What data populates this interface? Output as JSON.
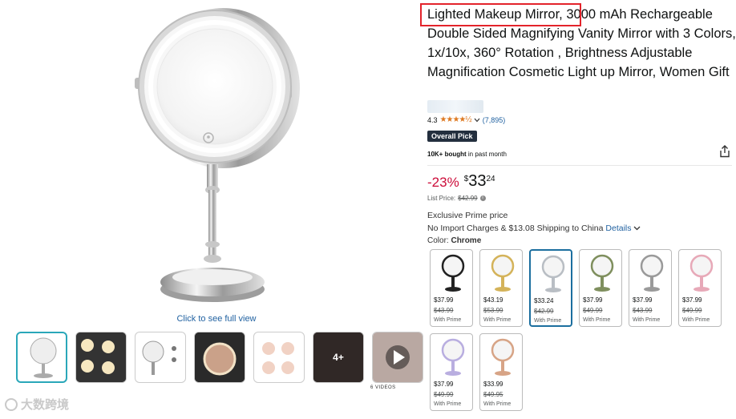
{
  "gallery": {
    "click_to_see_full_view": "Click to see full view",
    "thumbnails": [
      {
        "kind": "image",
        "active": true
      },
      {
        "kind": "image",
        "active": false
      },
      {
        "kind": "image",
        "active": false
      },
      {
        "kind": "image",
        "active": false
      },
      {
        "kind": "image",
        "active": false
      },
      {
        "kind": "image",
        "active": false,
        "overlay": "4+"
      },
      {
        "kind": "video",
        "active": false
      }
    ],
    "videos_label": "6 VIDEOS"
  },
  "product": {
    "title_highlight": "Lighted Makeup Mirror",
    "title_rest": ", 3000 mAh Rechargeable Double Sided Magnifying Vanity Mirror with 3 Colors, 1x/10x, 360° Rotation , Brightness Adjustable Magnification Cosmetic Light up Mirror, Women Gift",
    "rating": "4.3",
    "stars": "★★★★½",
    "review_count": "(7,895)",
    "badge": "Overall Pick",
    "bought_bold": "10K+ bought",
    "bought_rest": " in past month"
  },
  "price": {
    "discount": "-23%",
    "symbol": "$",
    "whole": "33",
    "fraction": "24",
    "list_price_label": "List Price:",
    "list_price_value": "$42.99",
    "exclusive": "Exclusive Prime price",
    "import_text": "No Import Charges & $13.08 Shipping to China",
    "details_link": "Details"
  },
  "color": {
    "label": "Color:",
    "selected": "Chrome",
    "options": [
      {
        "price": "$37.99",
        "list": "$43.99",
        "note": "With Prime",
        "frame": "#222222",
        "selected": false
      },
      {
        "price": "$43.19",
        "list": "$53.99",
        "note": "With Prime",
        "frame": "#d4b35a",
        "selected": false
      },
      {
        "price": "$33.24",
        "list": "$42.99",
        "note": "With Prime",
        "frame": "#b9bec4",
        "selected": true
      },
      {
        "price": "$37.99",
        "list": "$49.99",
        "note": "With Prime",
        "frame": "#7f8f5e",
        "selected": false
      },
      {
        "price": "$37.99",
        "list": "$43.99",
        "note": "With Prime",
        "frame": "#9a9a9a",
        "selected": false
      },
      {
        "price": "$37.99",
        "list": "$49.99",
        "note": "With Prime",
        "frame": "#e7a9b8",
        "selected": false
      },
      {
        "price": "$37.99",
        "list": "$49.99",
        "note": "With Prime",
        "frame": "#b9aee0",
        "selected": false
      },
      {
        "price": "$33.99",
        "list": "$49.95",
        "note": "With Prime",
        "frame": "#d7a486",
        "selected": false
      }
    ]
  },
  "watermark": "大数跨境",
  "colors": {
    "link": "#2162a1",
    "deal": "#CC0C39",
    "highlight_box": "#e3232b",
    "selected_border": "#1c6f9f"
  }
}
